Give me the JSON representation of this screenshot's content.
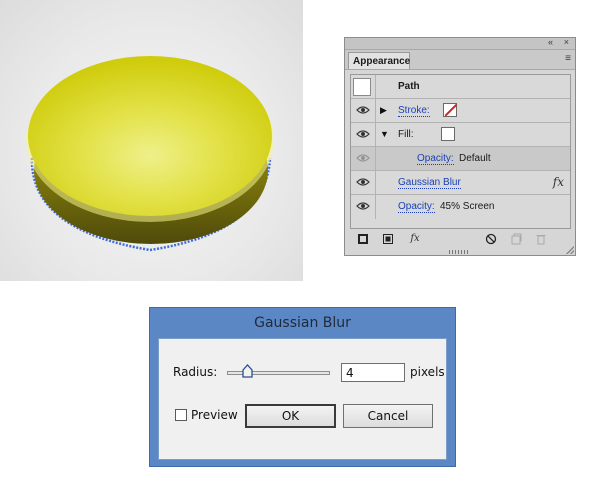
{
  "appearance_panel": {
    "tab_label": "Appearance",
    "titlebar_controls": [
      "«",
      "×"
    ],
    "menu_glyph": "≡",
    "rows": [
      {
        "id": "path",
        "label": "Path"
      },
      {
        "id": "stroke",
        "label": "Stroke:",
        "swatch": "none"
      },
      {
        "id": "fill",
        "label": "Fill:",
        "swatch": "white"
      },
      {
        "id": "fill-opacity",
        "label": "Opacity:",
        "value": "Default"
      },
      {
        "id": "gaussian-blur",
        "label": "Gaussian Blur",
        "fx": "fx"
      },
      {
        "id": "opacity",
        "label": "Opacity:",
        "value": "45% Screen"
      }
    ],
    "bottom_icons": [
      "add-new-stroke-icon",
      "add-new-fill-icon",
      "add-new-effect-icon",
      "clear-appearance-icon",
      "duplicate-item-icon",
      "delete-item-icon"
    ],
    "fx_label": "fx"
  },
  "dialog": {
    "title": "Gaussian Blur",
    "radius_label": "Radius:",
    "radius_value": "4",
    "radius_slider_fraction": 0.2,
    "units": "pixels",
    "preview_label": "Preview",
    "preview_checked": false,
    "ok_label": "OK",
    "cancel_label": "Cancel"
  },
  "colors": {
    "dialog_chrome": "#5b87c5",
    "ellipse_yellow": "#d9d600",
    "selection_blue": "#3f6cd8",
    "link_blue": "#1a3fb8"
  }
}
